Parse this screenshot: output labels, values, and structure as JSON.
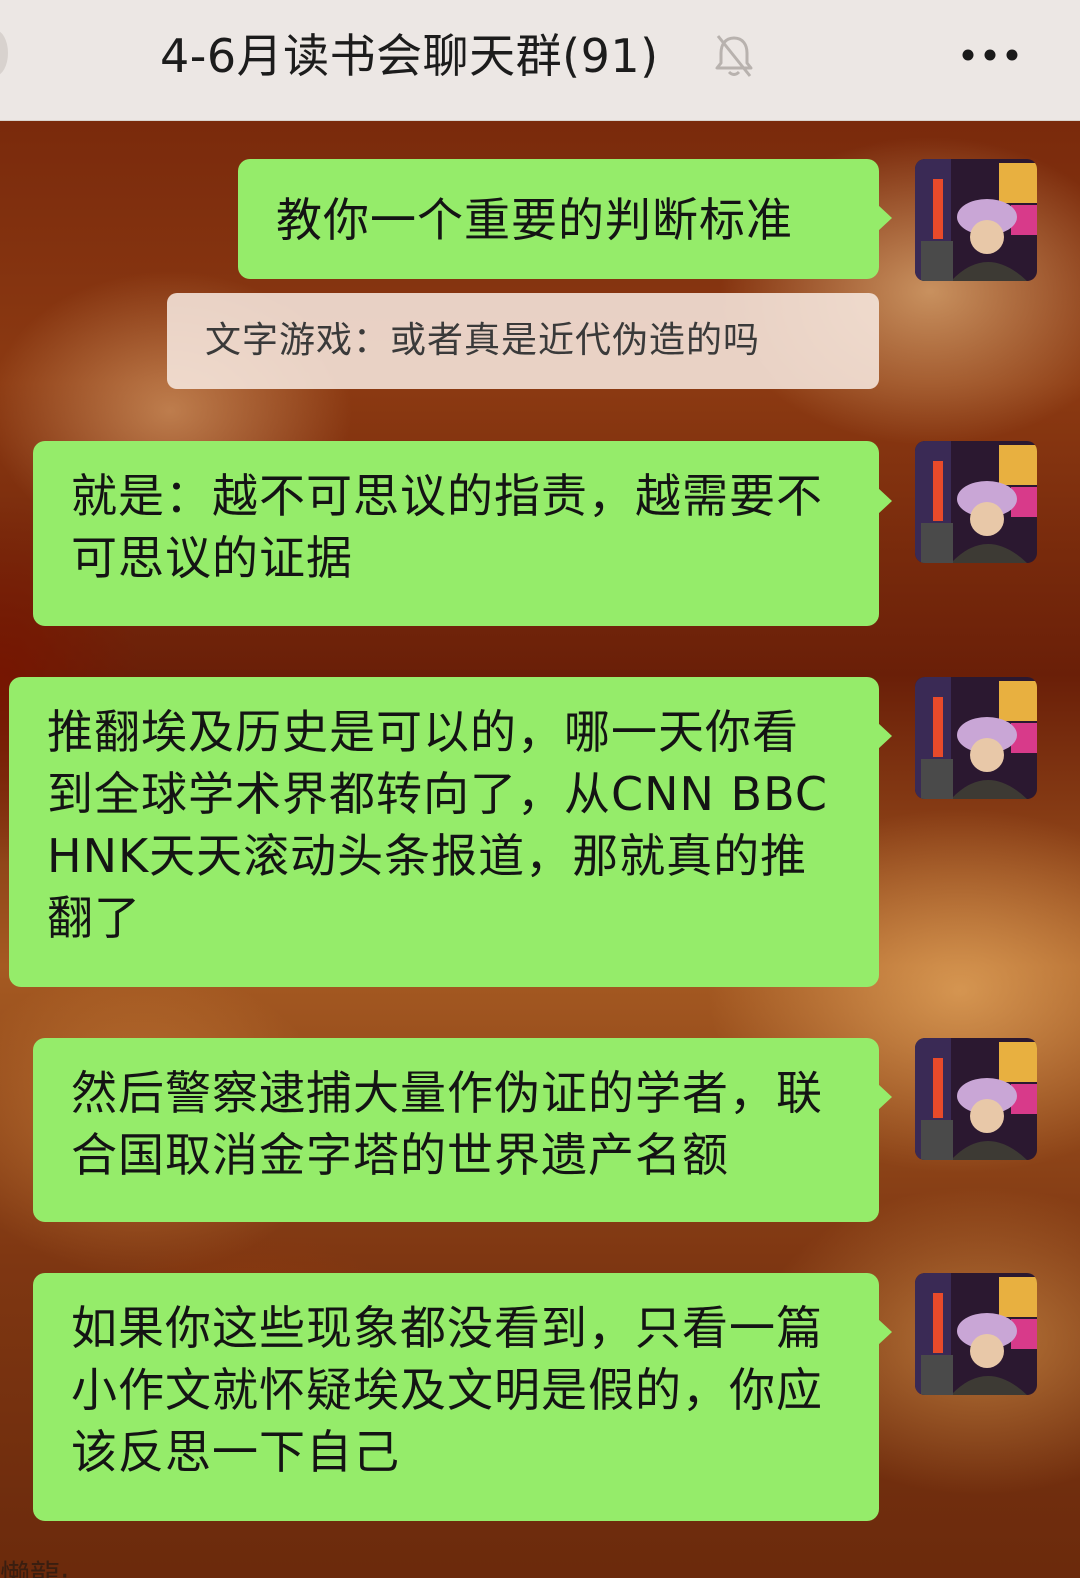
{
  "header": {
    "title": "4-6月读书会聊天群(91)",
    "mute_icon": "bell-slash-icon",
    "more_icon": "ellipsis-icon"
  },
  "messages": [
    {
      "text": "教你一个重要的判断标准",
      "avatar": "user-photo-avatar"
    },
    {
      "text": "就是：越不可思议的指责，越需要不可思议的证据",
      "avatar": "user-photo-avatar"
    },
    {
      "text": "推翻埃及历史是可以的，哪一天你看到全球学术界都转向了，从CNN BBC HNK天天滚动头条报道，那就真的推翻了",
      "avatar": "user-photo-avatar"
    },
    {
      "text": "然后警察逮捕大量作伪证的学者，联合国取消金字塔的世界遗产名额",
      "avatar": "user-photo-avatar"
    },
    {
      "text": "如果你这些现象都没看到，只看一篇小作文就怀疑埃及文明是假的，你应该反思一下自己",
      "avatar": "user-photo-avatar"
    }
  ],
  "quote": {
    "text": "文字游戏：或者真是近代伪造的吗"
  },
  "footer": {
    "partial_text": "懒龍·"
  },
  "colors": {
    "bubble": "#95ec6a",
    "header_bg": "#ece7e4"
  }
}
